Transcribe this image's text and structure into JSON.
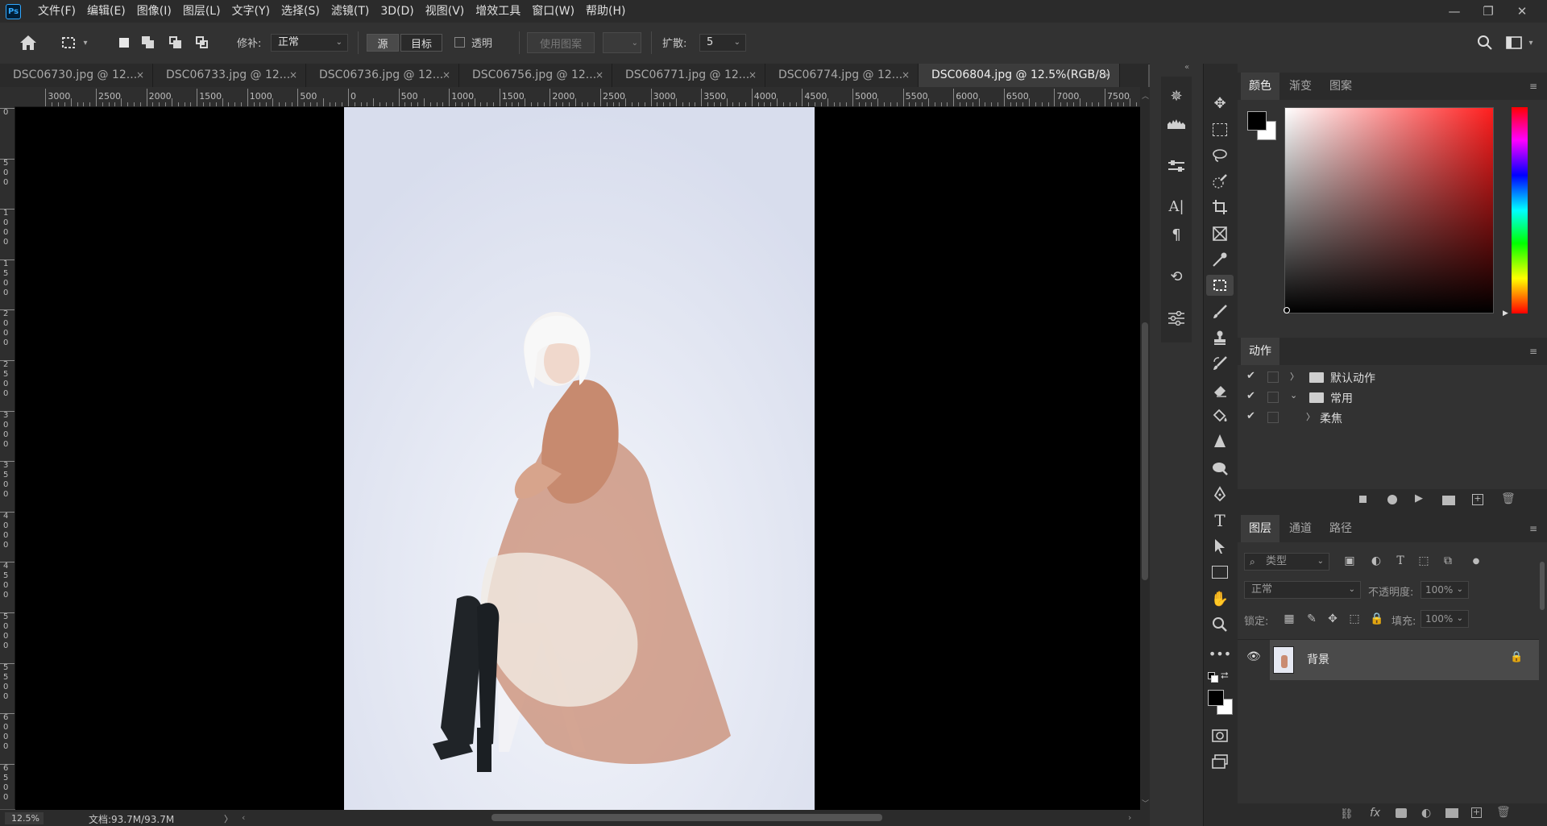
{
  "app": {
    "logo": "Ps"
  },
  "menu": [
    "文件(F)",
    "编辑(E)",
    "图像(I)",
    "图层(L)",
    "文字(Y)",
    "选择(S)",
    "滤镜(T)",
    "3D(D)",
    "视图(V)",
    "增效工具",
    "窗口(W)",
    "帮助(H)"
  ],
  "window_controls": {
    "minimize": "—",
    "restore": "❐",
    "close": "✕"
  },
  "options": {
    "patch_label": "修补:",
    "patch_value": "正常",
    "source_label": "源",
    "target_label": "目标",
    "transparent_label": "透明",
    "use_pattern_label": "使用图案",
    "diffusion_label": "扩散:",
    "diffusion_value": "5"
  },
  "tabs": [
    {
      "label": "DSC06730.jpg @ 12...",
      "close": "×"
    },
    {
      "label": "DSC06733.jpg @ 12...",
      "close": "×"
    },
    {
      "label": "DSC06736.jpg @ 12...",
      "close": "×"
    },
    {
      "label": "DSC06756.jpg @ 12...",
      "close": "×"
    },
    {
      "label": "DSC06771.jpg @ 12...",
      "close": "×"
    },
    {
      "label": "DSC06774.jpg @ 12...",
      "close": "×"
    },
    {
      "label": "DSC06804.jpg @ 12.5%(RGB/8)",
      "close": "×"
    }
  ],
  "ruler_h": [
    "3000",
    "2500",
    "2000",
    "1500",
    "1000",
    "500",
    "0",
    "500",
    "1000",
    "1500",
    "2000",
    "2500",
    "3000",
    "3500",
    "4000",
    "4500",
    "5000",
    "5500",
    "6000",
    "6500",
    "7000",
    "7500"
  ],
  "ruler_v": [
    "0",
    "500",
    "1000",
    "1500",
    "2000",
    "2500",
    "3000",
    "3500",
    "4000",
    "4500",
    "5000",
    "5500",
    "6000",
    "6500"
  ],
  "status": {
    "zoom": "12.5%",
    "doc": "文档:93.7M/93.7M",
    "arrow": "〉"
  },
  "color_panel": {
    "tabs": [
      "颜色",
      "渐变",
      "图案"
    ],
    "active": 0,
    "fg": "#000000",
    "bg": "#ffffff",
    "hue_color": "#ff1e1e"
  },
  "actions_panel": {
    "title": "动作",
    "rows": [
      {
        "label": "默认动作",
        "checked": true,
        "expanded": false,
        "indent": 0
      },
      {
        "label": "常用",
        "checked": true,
        "expanded": true,
        "indent": 0
      },
      {
        "label": "柔焦",
        "checked": true,
        "expanded": false,
        "indent": 1
      }
    ]
  },
  "layers_panel": {
    "tabs": [
      "图层",
      "通道",
      "路径"
    ],
    "active": 0,
    "filter_placeholder": "类型",
    "blend_mode": "正常",
    "opacity_label": "不透明度:",
    "opacity_value": "100%",
    "lock_label": "锁定:",
    "fill_label": "填充:",
    "fill_value": "100%",
    "layers": [
      {
        "name": "背景",
        "visible": true,
        "locked": true
      }
    ]
  }
}
